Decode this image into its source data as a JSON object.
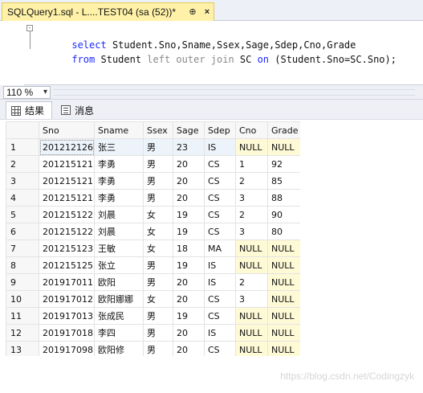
{
  "document_tab": {
    "title": "SQLQuery1.sql - L....TEST04 (sa (52))*",
    "pin_symbol": "⊕",
    "close_symbol": "×",
    "accent": "#fff2a8"
  },
  "editor": {
    "lines": [
      {
        "keyword": "select",
        "rest": " Student.Sno,Sname,Ssex,Sage,Sdep,Cno,Grade"
      },
      {
        "from_keyword": "from",
        "table1": " Student ",
        "join_text": "left outer join",
        "table2": " SC ",
        "on_keyword": "on",
        "condition": " (Student.Sno=SC.Sno);"
      }
    ]
  },
  "zoom": {
    "value": "110 %",
    "arrow": "▾"
  },
  "results_tabs": [
    {
      "label": "结果",
      "icon": "grid-icon"
    },
    {
      "label": "消息",
      "icon": "messages-icon"
    }
  ],
  "grid": {
    "columns": [
      "Sno",
      "Sname",
      "Ssex",
      "Sage",
      "Sdep",
      "Cno",
      "Grade"
    ],
    "rows": [
      {
        "num": "1",
        "cells": [
          "201212126",
          "张三",
          "男",
          "23",
          "IS",
          "NULL",
          "NULL"
        ]
      },
      {
        "num": "2",
        "cells": [
          "201215121",
          "李勇",
          "男",
          "20",
          "CS",
          "1",
          "92"
        ]
      },
      {
        "num": "3",
        "cells": [
          "201215121",
          "李勇",
          "男",
          "20",
          "CS",
          "2",
          "85"
        ]
      },
      {
        "num": "4",
        "cells": [
          "201215121",
          "李勇",
          "男",
          "20",
          "CS",
          "3",
          "88"
        ]
      },
      {
        "num": "5",
        "cells": [
          "201215122",
          "刘晨",
          "女",
          "19",
          "CS",
          "2",
          "90"
        ]
      },
      {
        "num": "6",
        "cells": [
          "201215122",
          "刘晨",
          "女",
          "19",
          "CS",
          "3",
          "80"
        ]
      },
      {
        "num": "7",
        "cells": [
          "201215123",
          "王敏",
          "女",
          "18",
          "MA",
          "NULL",
          "NULL"
        ]
      },
      {
        "num": "8",
        "cells": [
          "201215125",
          "张立",
          "男",
          "19",
          "IS",
          "NULL",
          "NULL"
        ]
      },
      {
        "num": "9",
        "cells": [
          "201917011",
          "欧阳",
          "男",
          "20",
          "IS",
          "2",
          "NULL"
        ]
      },
      {
        "num": "10",
        "cells": [
          "201917012",
          "欧阳娜娜",
          "女",
          "20",
          "CS",
          "3",
          "NULL"
        ]
      },
      {
        "num": "11",
        "cells": [
          "201917013",
          "张成民",
          "男",
          "19",
          "CS",
          "NULL",
          "NULL"
        ]
      },
      {
        "num": "12",
        "cells": [
          "201917018",
          "李四",
          "男",
          "20",
          "IS",
          "NULL",
          "NULL"
        ]
      },
      {
        "num": "13",
        "cells": [
          "201917098",
          "欧阳修",
          "男",
          "20",
          "CS",
          "NULL",
          "NULL"
        ]
      }
    ]
  },
  "watermark": "https://blog.csdn.net/Codingzyk",
  "colors": {
    "keyword": "#1b28ff",
    "null_cell": "#fffad6",
    "selected_row": "#edf3fa"
  }
}
